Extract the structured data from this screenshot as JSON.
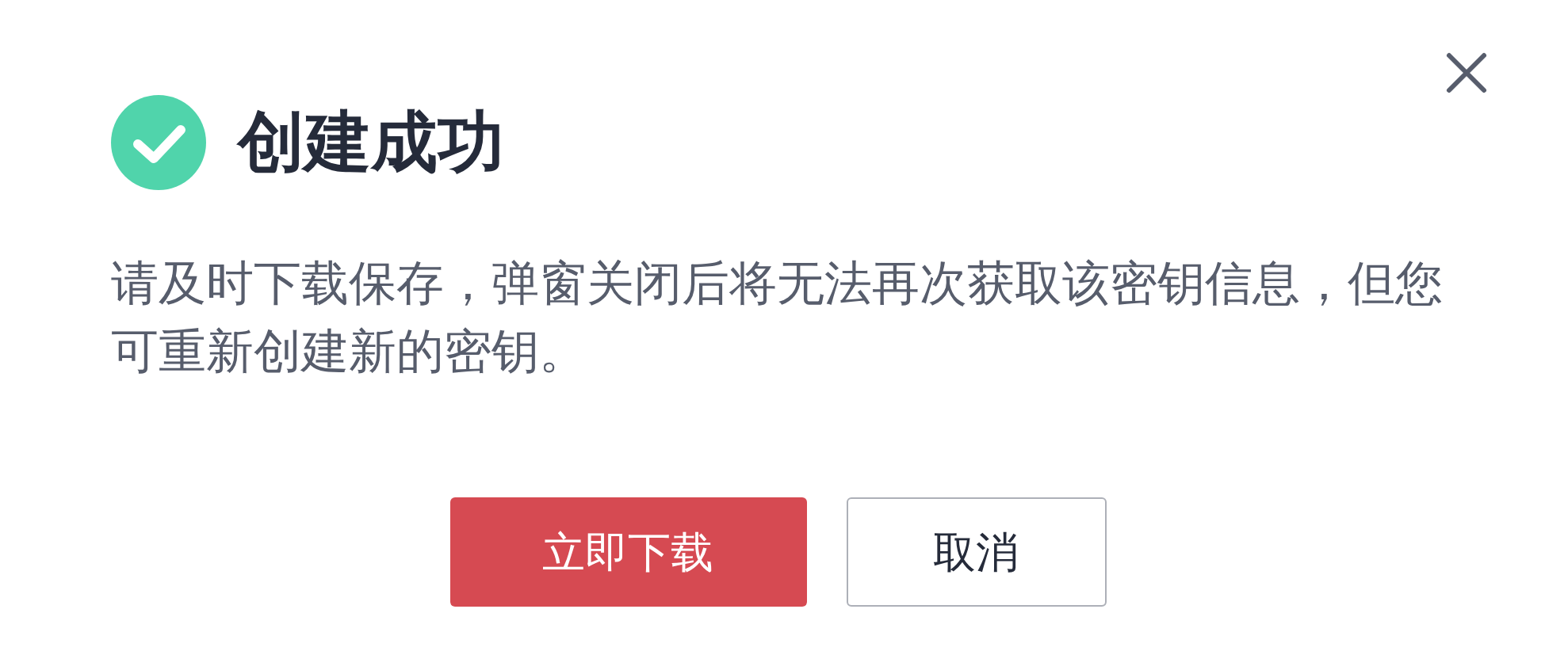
{
  "dialog": {
    "title": "创建成功",
    "message": "请及时下载保存，弹窗关闭后将无法再次获取该密钥信息，但您可重新创建新的密钥。",
    "buttons": [
      {
        "label": "立即下载",
        "kind": "primary"
      },
      {
        "label": "取消",
        "kind": "secondary"
      }
    ]
  }
}
